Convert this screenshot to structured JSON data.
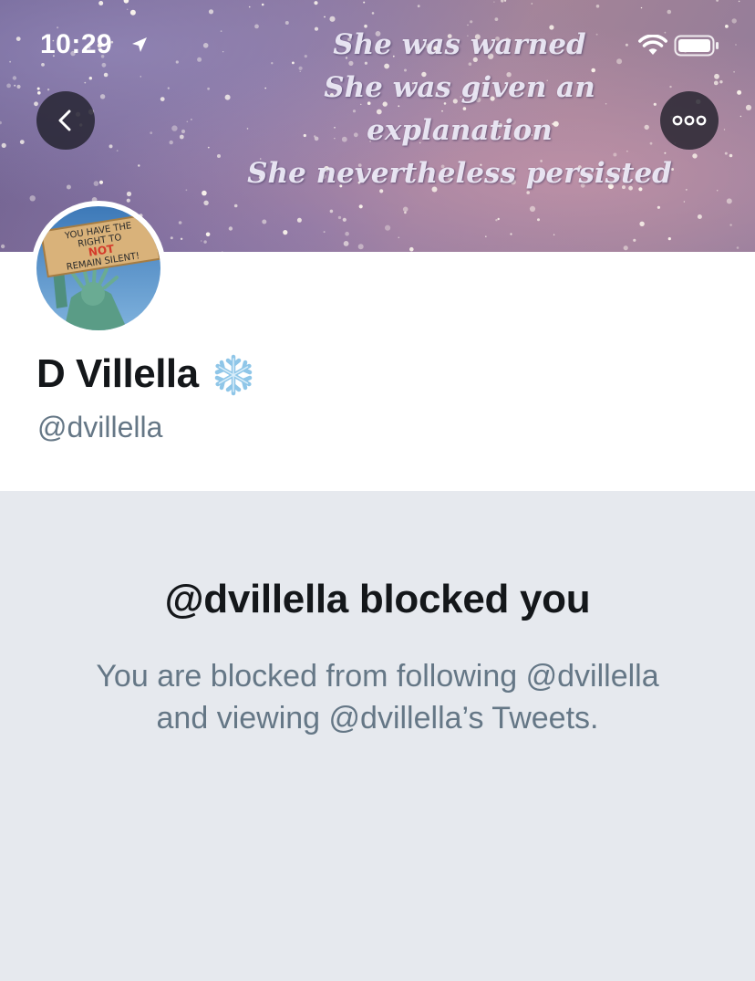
{
  "status_bar": {
    "time": "10:29",
    "icons": [
      "location-arrow-icon",
      "wifi-icon",
      "battery-icon"
    ]
  },
  "banner": {
    "quote_lines": [
      "She was warned",
      "She was given an",
      "explanation",
      "She nevertheless persisted"
    ]
  },
  "header": {
    "back_icon": "chevron-left-icon",
    "more_icon": "ellipsis-icon"
  },
  "profile": {
    "display_name": "D Villella",
    "name_emoji": "snowflake-icon",
    "handle": "@dvillella",
    "avatar_sign_lines": [
      "YOU HAVE THE",
      "RIGHT TO",
      "NOT",
      "REMAIN SILENT!"
    ]
  },
  "blocked": {
    "title": "@dvillella blocked you",
    "description": "You are blocked from following @dvillella and viewing @dvillella’s Tweets."
  },
  "colors": {
    "text_primary": "#14171a",
    "text_secondary": "#657786",
    "panel_bg": "#e6e9ee",
    "sign_red": "#d43a2a"
  }
}
